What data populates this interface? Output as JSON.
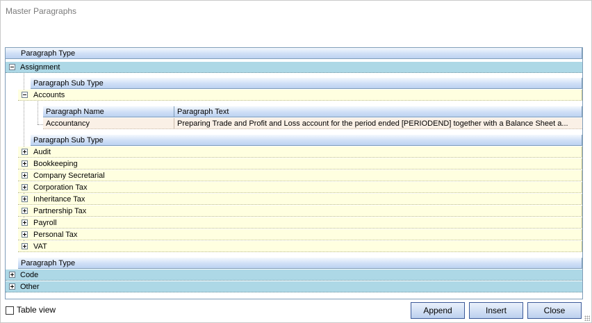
{
  "window": {
    "title": "Master Paragraphs"
  },
  "grid": {
    "type_header": "Paragraph Type",
    "subtype_header": "Paragraph Sub Type",
    "columns": {
      "name": "Paragraph Name",
      "text": "Paragraph Text"
    },
    "types": [
      {
        "label": "Assignment",
        "expanded": true,
        "expanded_subtype": {
          "label": "Accounts",
          "rows": [
            {
              "name": "Accountancy",
              "text": "Preparing Trade and Profit and Loss account for the period ended [PERIODEND] together with a Balance Sheet a..."
            }
          ]
        },
        "collapsed_subtypes": [
          "Audit",
          "Bookkeeping",
          "Company Secretarial",
          "Corporation Tax",
          "Inheritance Tax",
          "Partnership Tax",
          "Payroll",
          "Personal Tax",
          "VAT"
        ]
      },
      {
        "label": "Code",
        "expanded": false
      },
      {
        "label": "Other",
        "expanded": false
      }
    ]
  },
  "footer": {
    "table_view_label": "Table view",
    "table_view_checked": false,
    "append_label": "Append",
    "insert_label": "Insert",
    "close_label": "Close"
  }
}
